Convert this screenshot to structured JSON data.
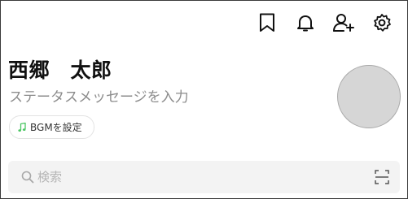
{
  "header": {
    "icons": [
      "bookmark-icon",
      "bell-icon",
      "add-friend-icon",
      "gear-icon"
    ]
  },
  "profile": {
    "name": "西郷　太郎",
    "status_placeholder": "ステータスメッセージを入力",
    "bgm_label": "BGMを設定",
    "bgm_icon": "music-note-icon",
    "bgm_icon_color": "#4cc764",
    "avatar_color": "#d6d6d6"
  },
  "search": {
    "placeholder": "検索",
    "value": "",
    "icons": [
      "search-icon",
      "scan-icon"
    ]
  }
}
